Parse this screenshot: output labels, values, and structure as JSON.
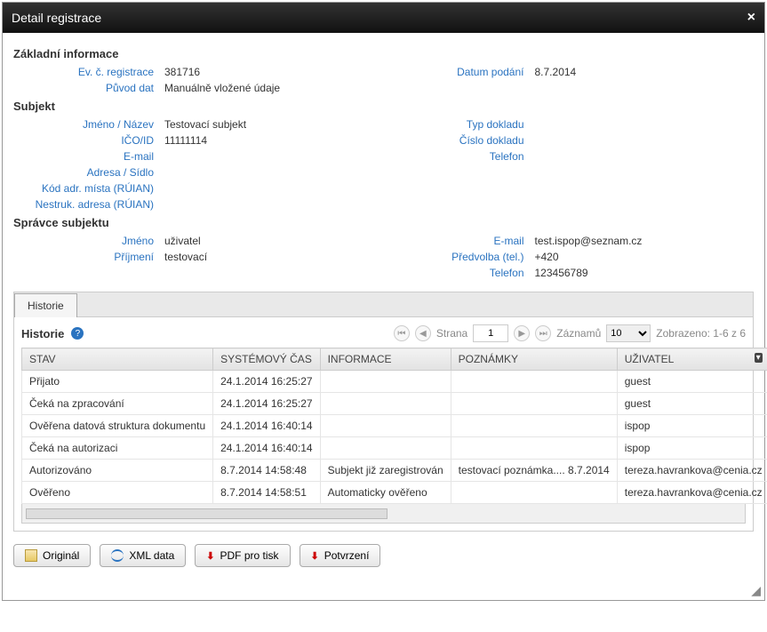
{
  "dialog": {
    "title": "Detail registrace"
  },
  "basic": {
    "heading": "Základní informace",
    "evLabel": "Ev. č. registrace",
    "evValue": "381716",
    "dateLabel": "Datum podání",
    "dateValue": "8.7.2014",
    "originLabel": "Původ dat",
    "originValue": "Manuálně vložené údaje"
  },
  "subject": {
    "heading": "Subjekt",
    "nameLabel": "Jméno / Název",
    "nameValue": "Testovací subjekt",
    "docTypeLabel": "Typ dokladu",
    "docTypeValue": "",
    "icoLabel": "IČO/ID",
    "icoValue": "11111114",
    "docNumLabel": "Číslo dokladu",
    "docNumValue": "",
    "emailLabel": "E-mail",
    "emailValue": "",
    "phoneLabel": "Telefon",
    "phoneValue": "",
    "addrLabel": "Adresa / Sídlo",
    "ruianCodeLabel": "Kód adr. místa (RÚIAN)",
    "ruianAddrLabel": "Nestruk. adresa (RÚIAN)"
  },
  "admin": {
    "heading": "Správce subjektu",
    "fnLabel": "Jméno",
    "fnValue": "uživatel",
    "emailLabel": "E-mail",
    "emailValue": "test.ispop@seznam.cz",
    "lnLabel": "Příjmení",
    "lnValue": "testovací",
    "prefixLabel": "Předvolba (tel.)",
    "prefixValue": "+420",
    "phoneLabel": "Telefon",
    "phoneValue": "123456789"
  },
  "tabs": {
    "history": "Historie"
  },
  "pager": {
    "title": "Historie",
    "pageLabel": "Strana",
    "page": "1",
    "recordsLabel": "Záznamů",
    "records": "10",
    "shown": "Zobrazeno: 1-6 z 6"
  },
  "cols": {
    "state": "STAV",
    "time": "SYSTÉMOVÝ ČAS",
    "info": "INFORMACE",
    "notes": "POZNÁMKY",
    "user": "UŽIVATEL"
  },
  "rows": [
    {
      "state": "Přijato",
      "time": "24.1.2014 16:25:27",
      "info": "",
      "notes": "",
      "user": "guest"
    },
    {
      "state": "Čeká na zpracování",
      "time": "24.1.2014 16:25:27",
      "info": "",
      "notes": "",
      "user": "guest"
    },
    {
      "state": "Ověřena datová struktura dokumentu",
      "time": "24.1.2014 16:40:14",
      "info": "",
      "notes": "",
      "user": "ispop"
    },
    {
      "state": "Čeká na autorizaci",
      "time": "24.1.2014 16:40:14",
      "info": "",
      "notes": "",
      "user": "ispop"
    },
    {
      "state": "Autorizováno",
      "time": "8.7.2014 14:58:48",
      "info": "Subjekt již zaregistrován",
      "notes": "testovací poznámka.... 8.7.2014",
      "user": "tereza.havrankova@cenia.cz"
    },
    {
      "state": "Ověřeno",
      "time": "8.7.2014 14:58:51",
      "info": "Automaticky ověřeno",
      "notes": "",
      "user": "tereza.havrankova@cenia.cz"
    }
  ],
  "buttons": {
    "original": "Originál",
    "xml": "XML data",
    "pdf": "PDF pro tisk",
    "confirm": "Potvrzení"
  }
}
